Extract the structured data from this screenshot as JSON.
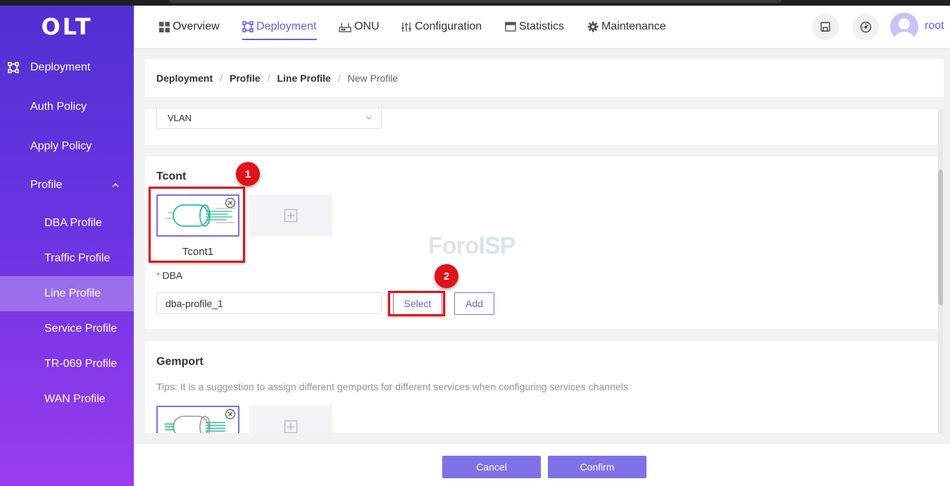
{
  "app": {
    "logo": "OLT",
    "username": "root"
  },
  "nav": {
    "items": [
      {
        "label": "Overview",
        "icon": "grid-icon",
        "active": false
      },
      {
        "label": "Deployment",
        "icon": "deployment-icon",
        "active": true
      },
      {
        "label": "ONU",
        "icon": "router-icon",
        "active": false
      },
      {
        "label": "Configuration",
        "icon": "sliders-icon",
        "active": false
      },
      {
        "label": "Statistics",
        "icon": "window-icon",
        "active": false
      },
      {
        "label": "Maintenance",
        "icon": "gear-icon",
        "active": false
      }
    ],
    "actions": [
      "save-icon",
      "dashboard-icon"
    ]
  },
  "sidebar": {
    "items": [
      {
        "label": "Deployment",
        "level": 0,
        "icon": "deployment-icon"
      },
      {
        "label": "Auth Policy",
        "level": 0
      },
      {
        "label": "Apply Policy",
        "level": 0
      },
      {
        "label": "Profile",
        "level": 0,
        "expanded": true
      },
      {
        "label": "DBA Profile",
        "level": 1
      },
      {
        "label": "Traffic Profile",
        "level": 1
      },
      {
        "label": "Line Profile",
        "level": 1,
        "active": true
      },
      {
        "label": "Service Profile",
        "level": 1
      },
      {
        "label": "TR-069 Profile",
        "level": 1
      },
      {
        "label": "WAN Profile",
        "level": 1
      }
    ]
  },
  "breadcrumb": [
    "Deployment",
    "Profile",
    "Line Profile",
    "New Profile"
  ],
  "form": {
    "mode_select": {
      "value": "VLAN"
    },
    "tcont": {
      "title": "Tcont",
      "tiles": [
        {
          "label": "Tcont1"
        }
      ],
      "dba_label": "DBA",
      "dba_value": "dba-profile_1",
      "select_button": "Select",
      "add_button": "Add"
    },
    "gemport": {
      "title": "Gemport",
      "tips": "Tips: It is a suggestion to assign different gemports for different services when configuring services channels"
    }
  },
  "footer": {
    "cancel": "Cancel",
    "confirm": "Confirm"
  },
  "annotations": {
    "badge1": "1",
    "badge2": "2",
    "color": "#e0121a"
  },
  "watermark": {
    "part1": "Foro",
    "part2": "ISP"
  },
  "colors": {
    "accent": "#6f5be0",
    "sidebar_top": "#5130d3",
    "sidebar_bottom": "#9a3cef",
    "primary_button": "#7f72e6"
  }
}
